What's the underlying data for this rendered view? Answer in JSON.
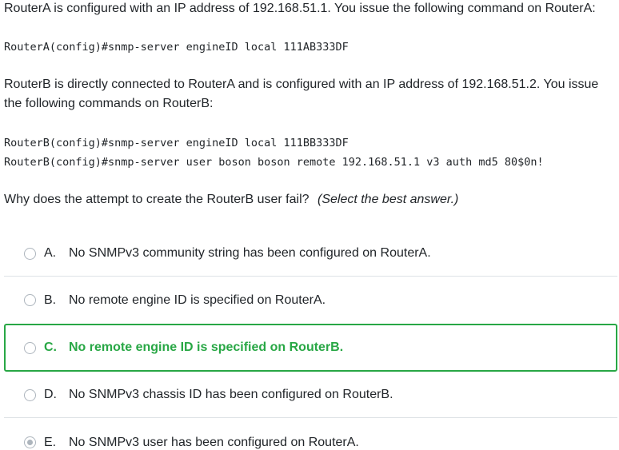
{
  "question": {
    "intro_a": "RouterA is configured with an IP address of 192.168.51.1. You issue the following command on RouterA:",
    "code_a": [
      "RouterA(config)#snmp-server engineID local 111AB333DF"
    ],
    "intro_b": "RouterB is directly connected to RouterA and is configured with an IP address of 192.168.51.2. You issue the following commands on RouterB:",
    "code_b": [
      "RouterB(config)#snmp-server engineID local 111BB333DF",
      "RouterB(config)#snmp-server user boson boson remote 192.168.51.1 v3 auth md5 80$0n!"
    ],
    "prompt": "Why does the attempt to create the RouterB user fail?",
    "instruction": "(Select the best answer.)"
  },
  "options": [
    {
      "letter": "A.",
      "text": "No SNMPv3 community string has been configured on RouterA.",
      "correct": false,
      "selected": false
    },
    {
      "letter": "B.",
      "text": "No remote engine ID is specified on RouterA.",
      "correct": false,
      "selected": false
    },
    {
      "letter": "C.",
      "text": "No remote engine ID is specified on RouterB.",
      "correct": true,
      "selected": false
    },
    {
      "letter": "D.",
      "text": "No SNMPv3 chassis ID has been configured on RouterB.",
      "correct": false,
      "selected": false
    },
    {
      "letter": "E.",
      "text": "No SNMPv3 user has been configured on RouterA.",
      "correct": false,
      "selected": true
    }
  ],
  "colors": {
    "correct": "#28a745",
    "text": "#212529",
    "divider": "#dee2e6",
    "radio_border": "#adb5bd"
  }
}
